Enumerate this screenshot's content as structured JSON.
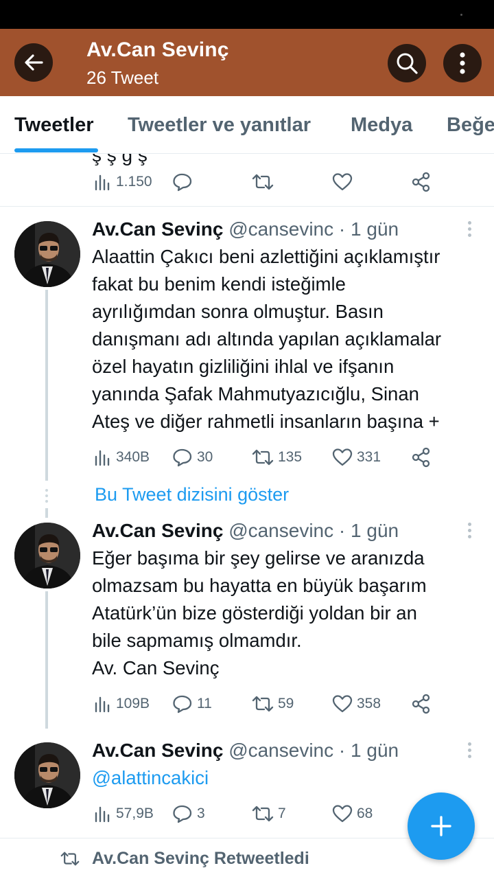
{
  "header": {
    "title": "Av.Can Sevinç",
    "subtitle": "26 Tweet"
  },
  "tabs": [
    {
      "label": "Tweetler",
      "active": true
    },
    {
      "label": "Tweetler ve yanıtlar",
      "active": false
    },
    {
      "label": "Medya",
      "active": false
    },
    {
      "label": "Beğeniler",
      "active": false
    }
  ],
  "partial_tweet": {
    "text_fragment": "ş ş ğ ş",
    "views": "1.150",
    "replies": "",
    "retweets": "",
    "likes": ""
  },
  "tweets": [
    {
      "name": "Av.Can Sevinç",
      "handle": "@cansevinc",
      "dot": "·",
      "time": "1 gün",
      "lines": [
        "Alaattin Çakıcı beni azlettiğini açıklamıştır",
        "fakat bu benim kendi isteğimle",
        "ayrılığımdan sonra olmuştur. Basın",
        "danışmanı adı altında yapılan açıklamalar",
        "özel hayatın gizliliğini ihlal ve ifşanın",
        "yanında Şafak Mahmutyazıcığlu, Sinan",
        "Ateş ve diğer rahmetli insanların başına +"
      ],
      "views": "340B",
      "replies": "30",
      "retweets": "135",
      "likes": "331"
    },
    {
      "name": "Av.Can Sevinç",
      "handle": "@cansevinc",
      "dot": "·",
      "time": "1 gün",
      "lines": [
        "Eğer başıma bir şey gelirse ve aranızda",
        "olmazsam bu hayatta en büyük başarım",
        "Atatürk’ün bize gösterdiği yoldan bir an",
        "bile sapmamış olmamdır.",
        "Av. Can Sevinç"
      ],
      "views": "109B",
      "replies": "11",
      "retweets": "59",
      "likes": "358"
    },
    {
      "name": "Av.Can Sevinç",
      "handle": "@cansevinc",
      "dot": "·",
      "time": "1 gün",
      "mention": "@alattincakici",
      "views": "57,9B",
      "replies": "3",
      "retweets": "7",
      "likes": "68"
    }
  ],
  "show_thread_label": "Bu Tweet dizisini göster",
  "retweeted_label": "Av.Can Sevinç Retweetledi",
  "colors": {
    "header_bg": "#a0522d",
    "accent": "#1d9bf0",
    "muted": "#536471"
  }
}
